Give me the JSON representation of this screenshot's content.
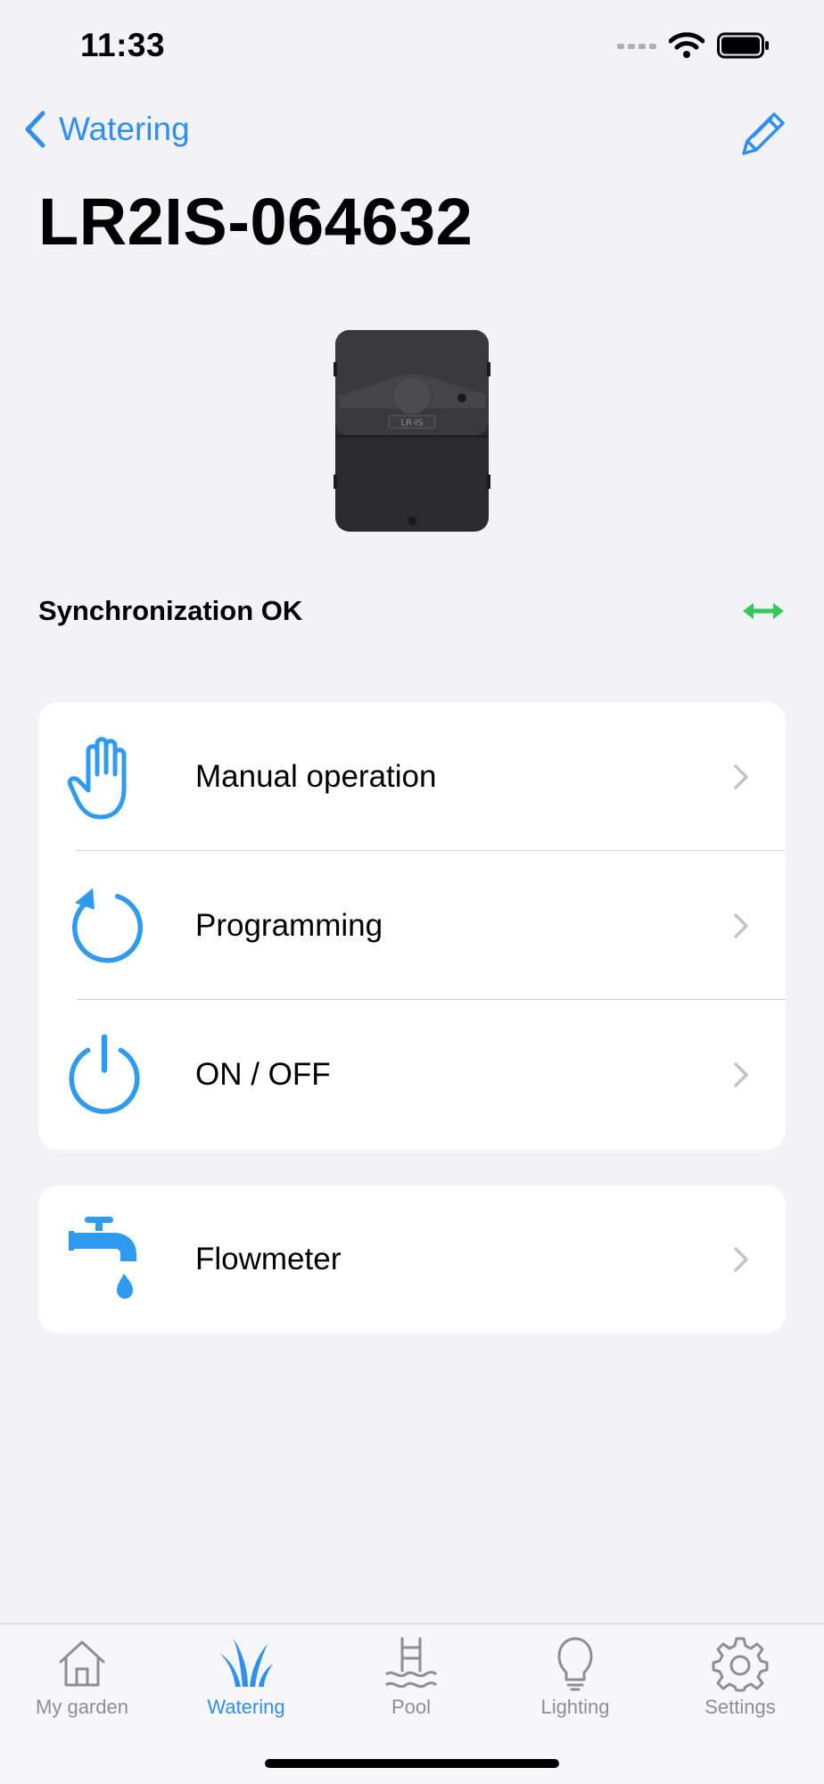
{
  "status_bar": {
    "time": "11:33"
  },
  "nav": {
    "back_label": "Watering"
  },
  "page": {
    "title": "LR2IS-064632"
  },
  "device": {
    "label": "LR-IS"
  },
  "sync": {
    "label": "Synchronization OK",
    "color": "#34c759"
  },
  "menu": {
    "items": [
      {
        "label": "Manual operation",
        "icon": "hand-icon"
      },
      {
        "label": "Programming",
        "icon": "refresh-icon"
      },
      {
        "label": "ON / OFF",
        "icon": "power-icon"
      }
    ],
    "flowmeter": {
      "label": "Flowmeter",
      "icon": "faucet-icon"
    }
  },
  "tabs": [
    {
      "label": "My garden",
      "icon": "house-icon",
      "active": false
    },
    {
      "label": "Watering",
      "icon": "grass-icon",
      "active": true
    },
    {
      "label": "Pool",
      "icon": "pool-ladder-icon",
      "active": false
    },
    {
      "label": "Lighting",
      "icon": "lightbulb-icon",
      "active": false
    },
    {
      "label": "Settings",
      "icon": "gear-icon",
      "active": false
    }
  ],
  "colors": {
    "accent": "#2f8ff0",
    "background": "#f2f2f7",
    "inactive": "#8e8e93"
  }
}
